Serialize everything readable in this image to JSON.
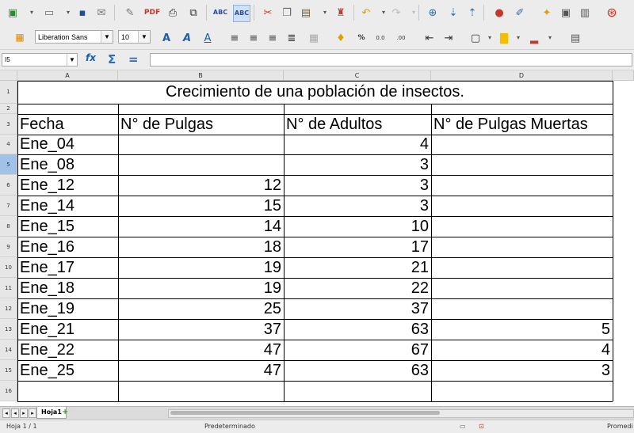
{
  "toolbar1": {
    "icons": [
      "new-document-icon",
      "open-icon",
      "save-icon",
      "email-icon",
      "edit-mode-icon",
      "export-pdf-icon",
      "print-icon",
      "print-preview-icon",
      "spellcheck-icon",
      "autospellcheck-icon",
      "cut-icon",
      "copy-icon",
      "paste-icon",
      "clone-formatting-icon",
      "undo-icon",
      "redo-icon",
      "hyperlink-icon",
      "sort-ascending-icon",
      "sort-descending-icon",
      "chart-icon",
      "draw-functions-icon",
      "navigator-icon",
      "gallery-icon",
      "datasources-icon",
      "help-icon"
    ]
  },
  "toolbar2": {
    "font_name": "Liberation Sans",
    "font_size": "10",
    "bold_label": "A",
    "italic_label": "A",
    "underline_label": "A",
    "percent_label": "%",
    "decimal_add_label": "0.0",
    "decimal_del_label": ".00"
  },
  "formula_bar": {
    "cell_ref": "I5",
    "function_wizard_label": "fx",
    "sum_label": "Σ",
    "equals_label": "=",
    "formula_value": ""
  },
  "sheet": {
    "columns": [
      "A",
      "B",
      "C",
      "D"
    ],
    "row_numbers": [
      "1",
      "2",
      "3",
      "4",
      "5",
      "6",
      "7",
      "8",
      "9",
      "10",
      "11",
      "12",
      "13",
      "14",
      "15",
      "16"
    ],
    "title": "Crecimiento de una población de insectos.",
    "headers": [
      "Fecha",
      "N° de Pulgas",
      "N° de Adultos",
      "N° de Pulgas Muertas"
    ],
    "rows": [
      {
        "fecha": "Ene_04",
        "pulgas": "",
        "adultos": "4",
        "muertas": ""
      },
      {
        "fecha": "Ene_08",
        "pulgas": "",
        "adultos": "3",
        "muertas": ""
      },
      {
        "fecha": "Ene_12",
        "pulgas": "12",
        "adultos": "3",
        "muertas": ""
      },
      {
        "fecha": "Ene_14",
        "pulgas": "15",
        "adultos": "3",
        "muertas": ""
      },
      {
        "fecha": "Ene_15",
        "pulgas": "14",
        "adultos": "10",
        "muertas": ""
      },
      {
        "fecha": "Ene_16",
        "pulgas": "18",
        "adultos": "17",
        "muertas": ""
      },
      {
        "fecha": "Ene_17",
        "pulgas": "19",
        "adultos": "21",
        "muertas": ""
      },
      {
        "fecha": "Ene_18",
        "pulgas": "19",
        "adultos": "22",
        "muertas": ""
      },
      {
        "fecha": "Ene_19",
        "pulgas": "25",
        "adultos": "37",
        "muertas": ""
      },
      {
        "fecha": "Ene_21",
        "pulgas": "37",
        "adultos": "63",
        "muertas": "5"
      },
      {
        "fecha": "Ene_22",
        "pulgas": "47",
        "adultos": "67",
        "muertas": "4"
      },
      {
        "fecha": "Ene_25",
        "pulgas": "47",
        "adultos": "63",
        "muertas": "3"
      }
    ]
  },
  "tabs": {
    "sheet_name": "Hoja1",
    "add_label": "+"
  },
  "status": {
    "sheet_info": "Hoja 1 / 1",
    "page_style": "Predeterminado",
    "aggregate": "Promedi"
  }
}
